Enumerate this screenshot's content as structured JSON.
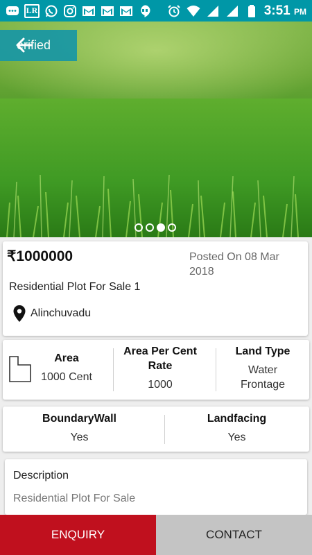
{
  "status_bar": {
    "time": "3:51",
    "ampm": "PM",
    "lr_text": "LR",
    "icons": [
      "message-icon",
      "lr-icon",
      "whatsapp-icon",
      "instagram-icon",
      "gmail-icon",
      "gmail-icon",
      "gmail-icon",
      "hangouts-icon",
      "alarm-icon",
      "wifi-icon",
      "signal-icon",
      "signal-icon",
      "battery-icon"
    ]
  },
  "hero": {
    "badge": "erified",
    "carousel_dots": 4,
    "active_dot_index": 2
  },
  "listing": {
    "price": "₹1000000",
    "posted": "Posted On  08 Mar 2018",
    "title": "Residential Plot For Sale 1",
    "location": "Alinchuvadu"
  },
  "details": {
    "area_label": "Area",
    "area_value": "1000 Cent",
    "rate_label": "Area Per Cent Rate",
    "rate_value": "1000",
    "land_type_label": "Land Type",
    "land_type_value": "Water Frontage"
  },
  "features": {
    "boundary_label": "BoundaryWall",
    "boundary_value": "Yes",
    "landfacing_label": "Landfacing",
    "landfacing_value": "Yes"
  },
  "description": {
    "label": "Description",
    "text": "Residential Plot For Sale"
  },
  "actions": {
    "enquiry": "ENQUIRY",
    "contact": "CONTACT"
  },
  "colors": {
    "status_bar": "#0097a7",
    "badge": "#1b98a3",
    "enquiry": "#c0101e",
    "contact": "#c4c4c4"
  }
}
